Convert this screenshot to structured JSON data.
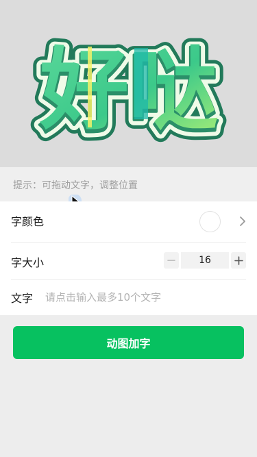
{
  "preview": {
    "sticker_text": "好哒",
    "colors": {
      "outline": "#227a5a",
      "inner_border": "#effbe8",
      "gradient_start": "#4fd48c",
      "gradient_end": "#aaf07a",
      "highlight": "#f5f26a",
      "accent_bar": "#1fb8aa"
    }
  },
  "hint": {
    "text": "提示：可拖动文字，调整位置"
  },
  "settings": {
    "font_color": {
      "label": "字颜色",
      "value_color": "#ffffff",
      "chevron_icon": "chevron-right-icon"
    },
    "font_size": {
      "label": "字大小",
      "value": "16",
      "decrement_icon": "minus-icon",
      "increment_icon": "plus-icon"
    },
    "text": {
      "label": "文字",
      "placeholder": "请点击输入最多10个文字",
      "value": ""
    }
  },
  "action": {
    "label": "动图加字"
  },
  "theme": {
    "primary": "#07c160",
    "page_bg": "#ededed"
  }
}
